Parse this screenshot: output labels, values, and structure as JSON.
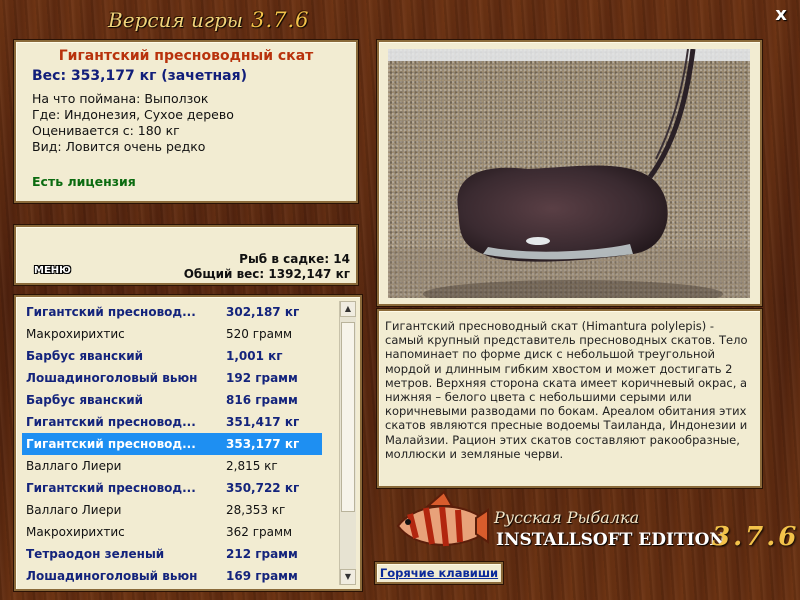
{
  "window": {
    "title": "Версия игры",
    "version": "3.7.6",
    "close_label": "x"
  },
  "fish_info": {
    "name": "Гигантский пресноводный скат",
    "weight": "Вес: 353,177 кг (зачетная)",
    "caught_on": "На что поймана: Выползок",
    "where": "Где: Индонезия, Сухое дерево",
    "valued_from": "Оценивается с: 180 кг",
    "kind": "Вид: Ловится очень редко",
    "license": "Есть лицензия"
  },
  "cage": {
    "menu_label": "МЕНЮ",
    "fish_count": "Рыб в садке: 14",
    "total_weight": "Общий вес: 1392,147 кг"
  },
  "catch_list": [
    {
      "name": "Гигантский пресновод...",
      "weight": "302,187 кг",
      "style": "bold"
    },
    {
      "name": "Макрохирихтис",
      "weight": "520 грамм",
      "style": "norm"
    },
    {
      "name": "Барбус яванский",
      "weight": "1,001 кг",
      "style": "bold"
    },
    {
      "name": "Лошадиноголовый вьюн",
      "weight": "192 грамм",
      "style": "bold"
    },
    {
      "name": "Барбус яванский",
      "weight": "816 грамм",
      "style": "bold"
    },
    {
      "name": "Гигантский пресновод...",
      "weight": "351,417 кг",
      "style": "bold"
    },
    {
      "name": "Гигантский пресновод...",
      "weight": "353,177 кг",
      "style": "sel"
    },
    {
      "name": "Валлаго Лиери",
      "weight": "2,815 кг",
      "style": "norm"
    },
    {
      "name": "Гигантский пресновод...",
      "weight": "350,722 кг",
      "style": "bold"
    },
    {
      "name": "Валлаго Лиери",
      "weight": "28,353 кг",
      "style": "norm"
    },
    {
      "name": "Макрохирихтис",
      "weight": "362 грамм",
      "style": "norm"
    },
    {
      "name": "Тетраодон зеленый",
      "weight": "212 грамм",
      "style": "bold"
    },
    {
      "name": "Лошадиноголовый вьюн",
      "weight": "169 грамм",
      "style": "bold"
    }
  ],
  "description": "Гигантский пресноводный скат (Himantura polylepis) - самый крупный представитель пресноводных скатов. Тело напоминает по форме диск с небольшой треугольной мордой и длинным гибким хвостом и может достигать 2 метров. Верхняя сторона ската имеет коричневый окрас, а нижняя – белого цвета с небольшими серыми или коричневыми разводами по бокам. Ареалом обитания этих скатов являются пресные водоемы Таиланда, Индонезии и Малайзии. Рацион этих скатов составляют ракообразные, моллюски и земляные черви.",
  "brand": {
    "line1": "Русская Рыбалка",
    "line2": "INSTALLSOFT EDITION",
    "version": "3.7.6"
  },
  "hotkeys_label": "Горячие клавиши",
  "colors": {
    "highlight": "#1e8ff2",
    "bold_text": "#14247c",
    "fish_name": "#b8320c",
    "license": "#0b6b10"
  }
}
